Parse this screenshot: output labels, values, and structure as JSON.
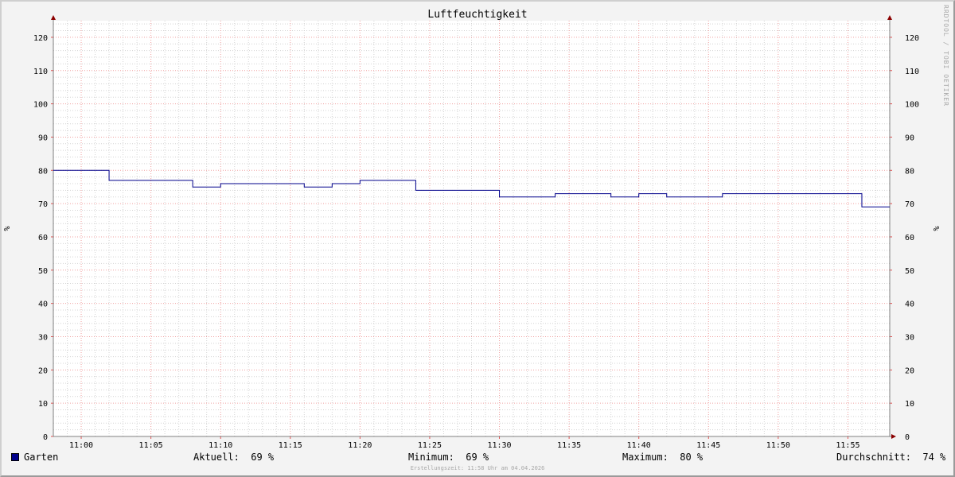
{
  "chart_data": {
    "type": "line",
    "title": "Luftfeuchtigkeit",
    "ylabel": "%",
    "ylim": [
      0,
      125
    ],
    "yticks": [
      0,
      10,
      20,
      30,
      40,
      50,
      60,
      70,
      80,
      90,
      100,
      110,
      120
    ],
    "xlim": [
      "10:58",
      "11:58"
    ],
    "xticks": [
      "11:00",
      "11:05",
      "11:10",
      "11:15",
      "11:20",
      "11:25",
      "11:30",
      "11:35",
      "11:40",
      "11:45",
      "11:50",
      "11:55"
    ],
    "grid": true,
    "series": [
      {
        "name": "Garten",
        "color": "#00008b",
        "x": [
          "10:58",
          "11:02",
          "11:08",
          "11:10",
          "11:16",
          "11:18",
          "11:20",
          "11:24",
          "11:26",
          "11:30",
          "11:34",
          "11:38",
          "11:40",
          "11:42",
          "11:46",
          "11:56",
          "11:58"
        ],
        "y": [
          80,
          77,
          75,
          76,
          75,
          76,
          77,
          74,
          74,
          72,
          73,
          72,
          73,
          72,
          73,
          69,
          69
        ]
      }
    ]
  },
  "legend": {
    "series_name": "Garten",
    "color": "#00008b",
    "current": "Aktuell:  69 %",
    "minimum": "Minimum:  69 %",
    "maximum": "Maximum:  80 %",
    "average": "Durchschnitt:  74 %"
  },
  "watermark": "RRDTOOL / TOBI OETIKER",
  "footer": "Erstellungszeit: 11:58 Uhr am 04.04.2026"
}
